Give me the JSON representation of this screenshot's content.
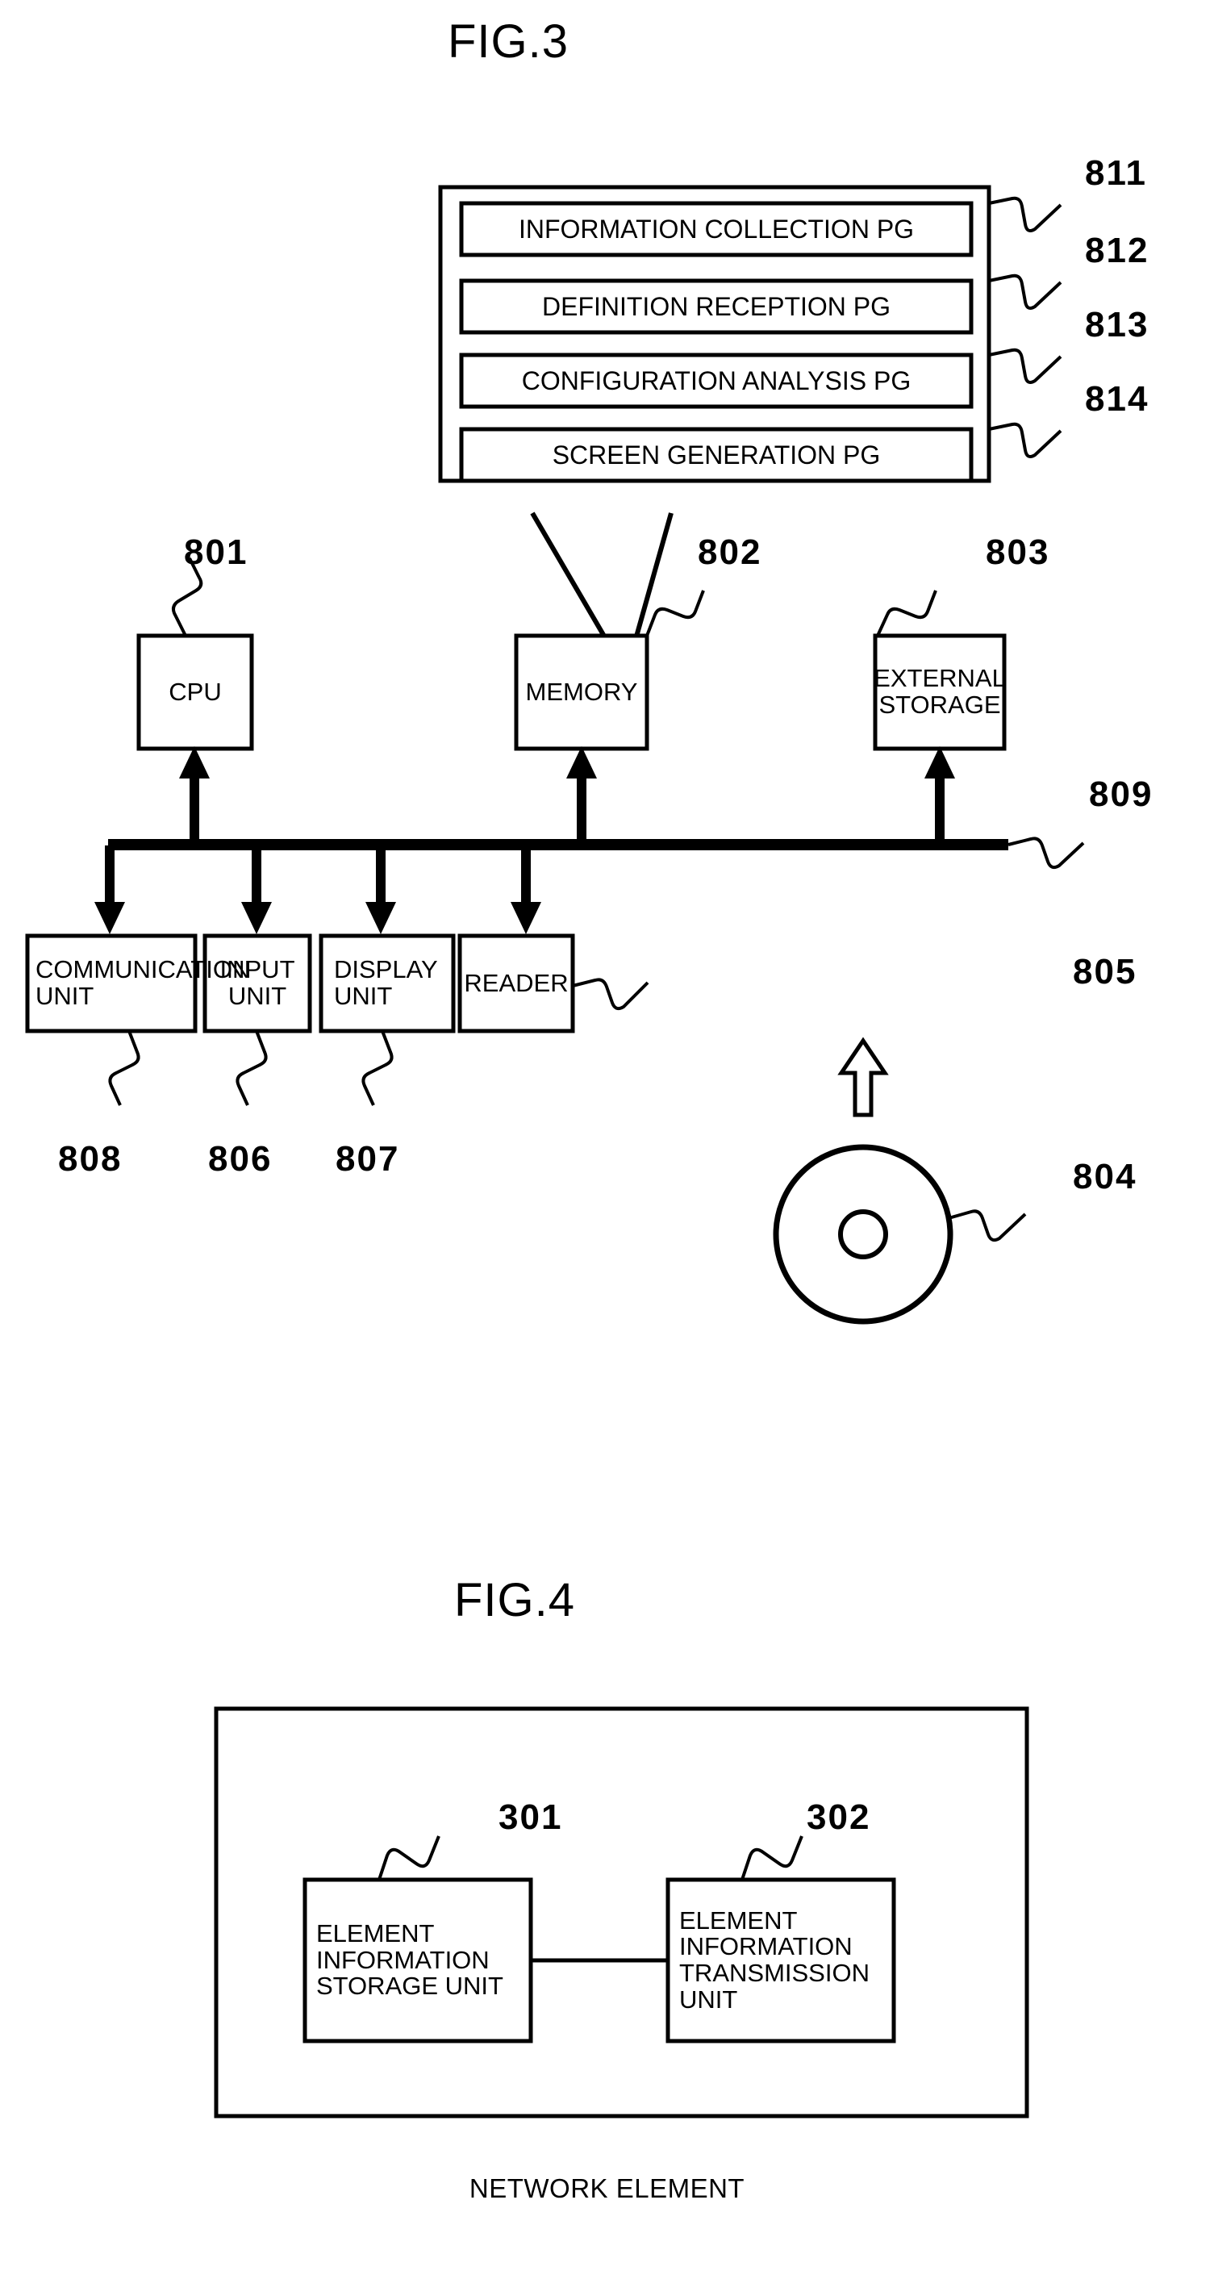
{
  "figures": [
    {
      "id": "fig3",
      "title": "FIG.3",
      "program_box": {
        "programs": [
          {
            "label": "INFORMATION COLLECTION PG",
            "ref": "811"
          },
          {
            "label": "DEFINITION RECEPTION PG",
            "ref": "812"
          },
          {
            "label": "CONFIGURATION ANALYSIS PG",
            "ref": "813"
          },
          {
            "label": "SCREEN GENERATION PG",
            "ref": "814"
          }
        ]
      },
      "top_row": [
        {
          "label": "CPU",
          "ref": "801"
        },
        {
          "label": "MEMORY",
          "ref": "802"
        },
        {
          "label": "EXTERNAL\nSTORAGE",
          "ref": "803"
        }
      ],
      "bus": {
        "ref": "809"
      },
      "bottom_row": [
        {
          "label": "COMMUNICATION\nUNIT",
          "ref": "808"
        },
        {
          "label": "INPUT\nUNIT",
          "ref": "806"
        },
        {
          "label": "DISPLAY\nUNIT",
          "ref": "807"
        },
        {
          "label": "READER",
          "ref": "805"
        }
      ],
      "media": {
        "name": "storage-disc",
        "ref": "804"
      }
    },
    {
      "id": "fig4",
      "title": "FIG.4",
      "caption": "NETWORK ELEMENT",
      "blocks": [
        {
          "label": "ELEMENT\nINFORMATION\nSTORAGE UNIT",
          "ref": "301"
        },
        {
          "label": "ELEMENT\nINFORMATION\nTRANSMISSION\nUNIT",
          "ref": "302"
        }
      ]
    }
  ],
  "style": {
    "ink": "#000000",
    "paper": "#ffffff"
  }
}
